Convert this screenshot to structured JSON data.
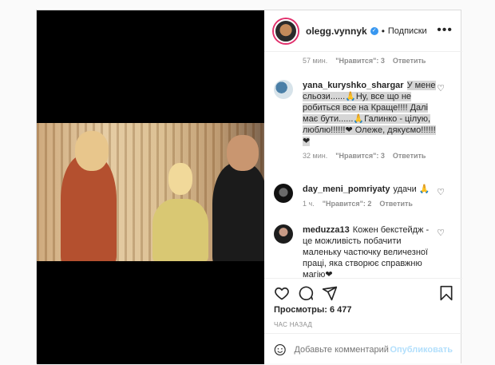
{
  "post": {
    "username": "olegg.vynnyk",
    "follow_label": "Подписки",
    "views_label": "Просмотры: 6 477",
    "time_label": "ЧАС НАЗАД",
    "comment_placeholder": "Добавьте комментарий...",
    "publish_label": "Опубликовать"
  },
  "prev_meta": {
    "time": "57 мин.",
    "likes": "\"Нравится\": 3",
    "reply": "Ответить"
  },
  "comments": [
    {
      "user": "yana_kuryshko_shargar",
      "text": "У мене сльози......🙏Ну, все що не робиться все на Краще!!!! Далі має бути......🙏Галинко - цілую, люблю!!!!!!❤ Олеже, дякуємо!!!!!!❤",
      "time": "32 мин.",
      "likes": "\"Нравится\": 3",
      "reply": "Ответить"
    },
    {
      "user": "day_meni_pomriyaty",
      "text": "удачи 🙏",
      "time": "1 ч.",
      "likes": "\"Нравится\": 2",
      "reply": "Ответить"
    },
    {
      "user": "meduzza13",
      "text": "Кожен бекстейдж - це можливість побачити маленьку частючку величезної праці, яка створює справжню магію❤"
    }
  ],
  "icons": [
    "heart-icon",
    "comment-icon",
    "share-icon",
    "bookmark-icon",
    "emoji-icon",
    "more-icon",
    "verified-icon"
  ],
  "colors": {
    "verified": "#3897f0",
    "publish": "#b2dffc",
    "highlight": "#d6d6d6"
  }
}
